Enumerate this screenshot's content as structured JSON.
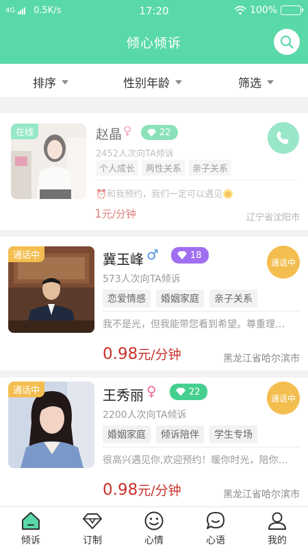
{
  "status_bar": {
    "network": "4G",
    "speed": "0.5K/s",
    "time": "17:20",
    "battery": "100%"
  },
  "header": {
    "title": "倾心倾诉"
  },
  "filters": [
    {
      "label": "排序"
    },
    {
      "label": "性别年龄"
    },
    {
      "label": "筛选"
    }
  ],
  "counselors": [
    {
      "status": "在线",
      "name": "赵晶",
      "gender_symbol": "♀",
      "level": "22",
      "consults": "2452人次向TA倾诉",
      "tags": [
        "个人成长",
        "两性关系",
        "亲子关系"
      ],
      "bio": "⏰和我预约，我们一定可以遇见🌞",
      "price_value": "1",
      "price_unit": "元/分钟",
      "location": "辽宁省沈阳市"
    },
    {
      "status": "通话中",
      "name": "冀玉峰",
      "gender_symbol": "♂",
      "level": "18",
      "consults": "573人次向TA倾诉",
      "tags": [
        "恋爱情感",
        "婚姻家庭",
        "亲子关系"
      ],
      "bio": "我不是光，但我能带您看到希望。尊重理…",
      "price_value": "0.98",
      "price_unit": "元/分钟",
      "location": "黑龙江省哈尔滨市",
      "badge": "通话中"
    },
    {
      "status": "通话中",
      "name": "王秀丽",
      "gender_symbol": "♀",
      "level": "22",
      "consults": "2200人次向TA倾诉",
      "tags": [
        "婚姻家庭",
        "倾诉陪伴",
        "学生专场"
      ],
      "bio": "很高兴遇见你,欢迎预约！暖你时光，陪你…",
      "price_value": "0.98",
      "price_unit": "元/分钟",
      "location": "黑龙江省哈尔滨市",
      "badge": "通话中"
    }
  ],
  "tabs": [
    {
      "label": "倾诉",
      "icon": "home-icon"
    },
    {
      "label": "订制",
      "icon": "diamond-icon"
    },
    {
      "label": "心情",
      "icon": "smile-icon"
    },
    {
      "label": "心语",
      "icon": "chat-icon"
    },
    {
      "label": "我的",
      "icon": "person-icon"
    }
  ],
  "colors": {
    "brand": "#5ad9a8",
    "price": "#c9312c",
    "oncall": "#f3be4f",
    "level_green": "#45cf8f",
    "level_purple": "#a06ef0"
  }
}
